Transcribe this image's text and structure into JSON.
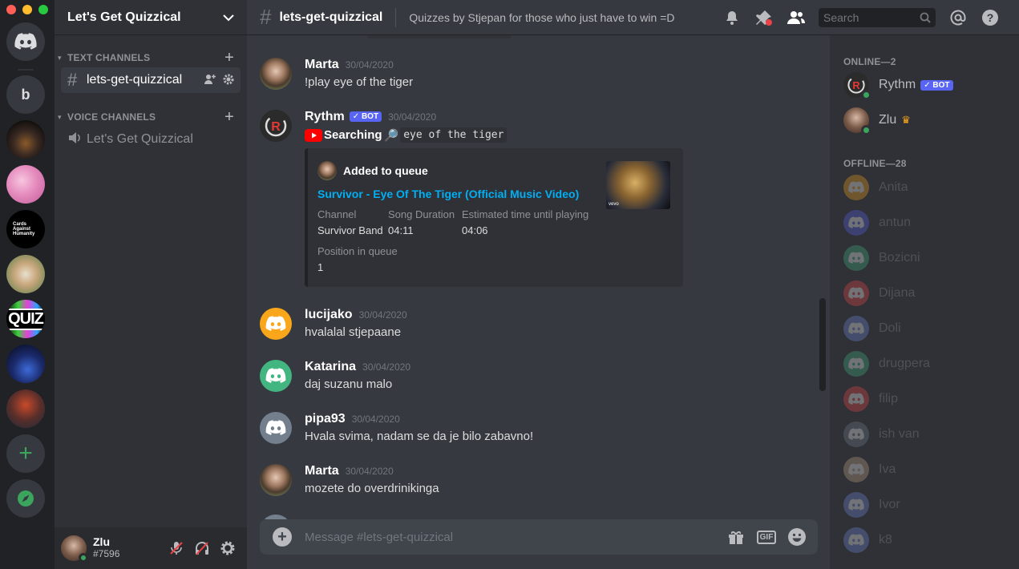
{
  "server": {
    "name": "Let's Get Quizzical",
    "rail": {
      "b_label": "b",
      "cah_label": "Cards Against Humanity",
      "quiz_label": "QUIZ"
    }
  },
  "sidebar": {
    "text_category": "TEXT CHANNELS",
    "voice_category": "VOICE CHANNELS",
    "text_channel": "lets-get-quizzical",
    "voice_channel": "Let's Get Quizzical"
  },
  "user": {
    "name": "Zlu",
    "tag": "#7596"
  },
  "header": {
    "channel": "lets-get-quizzical",
    "topic": "Quizzes by Stjepan for those who just have to win =D",
    "search_placeholder": "Search"
  },
  "messages": [
    {
      "author": "Marta",
      "timestamp": "30/04/2020",
      "text": "!play eye of the tiger"
    },
    {
      "author": "Rythm",
      "badge": "BOT",
      "timestamp": "30/04/2020",
      "searching": "Searching",
      "query": "eye of the tiger"
    },
    {
      "author": "lucijako",
      "timestamp": "30/04/2020",
      "text": "hvalalal stjepaane"
    },
    {
      "author": "Katarina",
      "timestamp": "30/04/2020",
      "text": "daj suzanu malo"
    },
    {
      "author": "pipa93",
      "timestamp": "30/04/2020",
      "text": "Hvala svima, nadam se da je bilo zabavno!"
    },
    {
      "author": "Marta",
      "timestamp": "30/04/2020",
      "text": "mozete do overdrinikinga"
    }
  ],
  "embed": {
    "author": "Added to queue",
    "title": "Survivor - Eye Of The Tiger (Official Music Video)",
    "fields": [
      {
        "name": "Channel",
        "value": "Survivor Band"
      },
      {
        "name": "Song Duration",
        "value": "04:11"
      },
      {
        "name": "Estimated time until playing",
        "value": "04:06"
      },
      {
        "name": "Position in queue",
        "value": "1"
      }
    ],
    "thumb_label": "vevo"
  },
  "composer": {
    "placeholder": "Message #lets-get-quizzical",
    "gif_label": "GIF"
  },
  "members": {
    "online_header": "ONLINE—2",
    "offline_header": "OFFLINE—28",
    "online": [
      {
        "name": "Rythm",
        "badge": "BOT"
      },
      {
        "name": "Zlu",
        "crown": "♛"
      }
    ],
    "offline": [
      "Anita",
      "antun",
      "Bozicni",
      "Dijana",
      "Doli",
      "drugpera",
      "filip",
      "ish van",
      "Iva",
      "Ivor",
      "k8"
    ],
    "offline_colors": [
      "#faa61a",
      "#5865f2",
      "#43b581",
      "#f04747",
      "#7289da",
      "#43b581",
      "#f04747",
      "#747f8d",
      "#c9a98a",
      "#7289da",
      "#7289da"
    ]
  }
}
